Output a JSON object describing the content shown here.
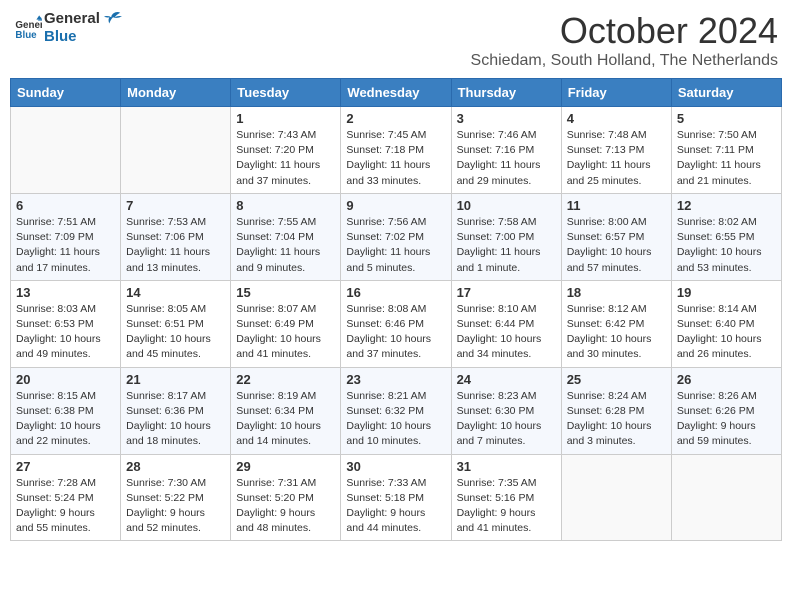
{
  "header": {
    "logo_line1": "General",
    "logo_line2": "Blue",
    "month": "October 2024",
    "location": "Schiedam, South Holland, The Netherlands"
  },
  "weekdays": [
    "Sunday",
    "Monday",
    "Tuesday",
    "Wednesday",
    "Thursday",
    "Friday",
    "Saturday"
  ],
  "weeks": [
    [
      {
        "day": "",
        "info": ""
      },
      {
        "day": "",
        "info": ""
      },
      {
        "day": "1",
        "info": "Sunrise: 7:43 AM\nSunset: 7:20 PM\nDaylight: 11 hours\nand 37 minutes."
      },
      {
        "day": "2",
        "info": "Sunrise: 7:45 AM\nSunset: 7:18 PM\nDaylight: 11 hours\nand 33 minutes."
      },
      {
        "day": "3",
        "info": "Sunrise: 7:46 AM\nSunset: 7:16 PM\nDaylight: 11 hours\nand 29 minutes."
      },
      {
        "day": "4",
        "info": "Sunrise: 7:48 AM\nSunset: 7:13 PM\nDaylight: 11 hours\nand 25 minutes."
      },
      {
        "day": "5",
        "info": "Sunrise: 7:50 AM\nSunset: 7:11 PM\nDaylight: 11 hours\nand 21 minutes."
      }
    ],
    [
      {
        "day": "6",
        "info": "Sunrise: 7:51 AM\nSunset: 7:09 PM\nDaylight: 11 hours\nand 17 minutes."
      },
      {
        "day": "7",
        "info": "Sunrise: 7:53 AM\nSunset: 7:06 PM\nDaylight: 11 hours\nand 13 minutes."
      },
      {
        "day": "8",
        "info": "Sunrise: 7:55 AM\nSunset: 7:04 PM\nDaylight: 11 hours\nand 9 minutes."
      },
      {
        "day": "9",
        "info": "Sunrise: 7:56 AM\nSunset: 7:02 PM\nDaylight: 11 hours\nand 5 minutes."
      },
      {
        "day": "10",
        "info": "Sunrise: 7:58 AM\nSunset: 7:00 PM\nDaylight: 11 hours\nand 1 minute."
      },
      {
        "day": "11",
        "info": "Sunrise: 8:00 AM\nSunset: 6:57 PM\nDaylight: 10 hours\nand 57 minutes."
      },
      {
        "day": "12",
        "info": "Sunrise: 8:02 AM\nSunset: 6:55 PM\nDaylight: 10 hours\nand 53 minutes."
      }
    ],
    [
      {
        "day": "13",
        "info": "Sunrise: 8:03 AM\nSunset: 6:53 PM\nDaylight: 10 hours\nand 49 minutes."
      },
      {
        "day": "14",
        "info": "Sunrise: 8:05 AM\nSunset: 6:51 PM\nDaylight: 10 hours\nand 45 minutes."
      },
      {
        "day": "15",
        "info": "Sunrise: 8:07 AM\nSunset: 6:49 PM\nDaylight: 10 hours\nand 41 minutes."
      },
      {
        "day": "16",
        "info": "Sunrise: 8:08 AM\nSunset: 6:46 PM\nDaylight: 10 hours\nand 37 minutes."
      },
      {
        "day": "17",
        "info": "Sunrise: 8:10 AM\nSunset: 6:44 PM\nDaylight: 10 hours\nand 34 minutes."
      },
      {
        "day": "18",
        "info": "Sunrise: 8:12 AM\nSunset: 6:42 PM\nDaylight: 10 hours\nand 30 minutes."
      },
      {
        "day": "19",
        "info": "Sunrise: 8:14 AM\nSunset: 6:40 PM\nDaylight: 10 hours\nand 26 minutes."
      }
    ],
    [
      {
        "day": "20",
        "info": "Sunrise: 8:15 AM\nSunset: 6:38 PM\nDaylight: 10 hours\nand 22 minutes."
      },
      {
        "day": "21",
        "info": "Sunrise: 8:17 AM\nSunset: 6:36 PM\nDaylight: 10 hours\nand 18 minutes."
      },
      {
        "day": "22",
        "info": "Sunrise: 8:19 AM\nSunset: 6:34 PM\nDaylight: 10 hours\nand 14 minutes."
      },
      {
        "day": "23",
        "info": "Sunrise: 8:21 AM\nSunset: 6:32 PM\nDaylight: 10 hours\nand 10 minutes."
      },
      {
        "day": "24",
        "info": "Sunrise: 8:23 AM\nSunset: 6:30 PM\nDaylight: 10 hours\nand 7 minutes."
      },
      {
        "day": "25",
        "info": "Sunrise: 8:24 AM\nSunset: 6:28 PM\nDaylight: 10 hours\nand 3 minutes."
      },
      {
        "day": "26",
        "info": "Sunrise: 8:26 AM\nSunset: 6:26 PM\nDaylight: 9 hours\nand 59 minutes."
      }
    ],
    [
      {
        "day": "27",
        "info": "Sunrise: 7:28 AM\nSunset: 5:24 PM\nDaylight: 9 hours\nand 55 minutes."
      },
      {
        "day": "28",
        "info": "Sunrise: 7:30 AM\nSunset: 5:22 PM\nDaylight: 9 hours\nand 52 minutes."
      },
      {
        "day": "29",
        "info": "Sunrise: 7:31 AM\nSunset: 5:20 PM\nDaylight: 9 hours\nand 48 minutes."
      },
      {
        "day": "30",
        "info": "Sunrise: 7:33 AM\nSunset: 5:18 PM\nDaylight: 9 hours\nand 44 minutes."
      },
      {
        "day": "31",
        "info": "Sunrise: 7:35 AM\nSunset: 5:16 PM\nDaylight: 9 hours\nand 41 minutes."
      },
      {
        "day": "",
        "info": ""
      },
      {
        "day": "",
        "info": ""
      }
    ]
  ]
}
